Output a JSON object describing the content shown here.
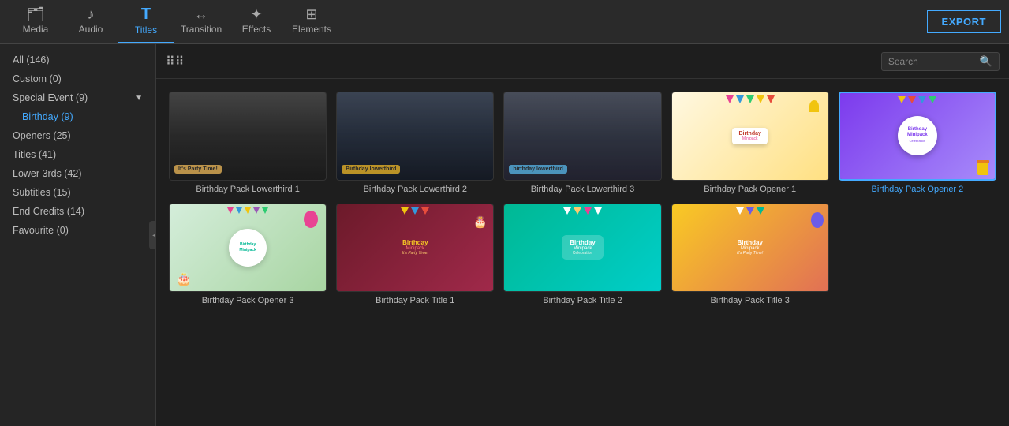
{
  "topNav": {
    "items": [
      {
        "id": "media",
        "label": "Media",
        "icon": "🗂"
      },
      {
        "id": "audio",
        "label": "Audio",
        "icon": "♪"
      },
      {
        "id": "titles",
        "label": "Titles",
        "icon": "T",
        "active": true
      },
      {
        "id": "transition",
        "label": "Transition",
        "icon": "↔"
      },
      {
        "id": "effects",
        "label": "Effects",
        "icon": "✦"
      },
      {
        "id": "elements",
        "label": "Elements",
        "icon": "⊞"
      }
    ],
    "exportLabel": "EXPORT"
  },
  "sidebar": {
    "items": [
      {
        "label": "All (146)",
        "active": false,
        "indent": false
      },
      {
        "label": "Custom (0)",
        "active": false,
        "indent": false
      },
      {
        "label": "Special Event (9)",
        "active": false,
        "indent": false,
        "hasArrow": true
      },
      {
        "label": "Birthday (9)",
        "active": true,
        "indent": true
      },
      {
        "label": "Openers (25)",
        "active": false,
        "indent": false
      },
      {
        "label": "Titles (41)",
        "active": false,
        "indent": false
      },
      {
        "label": "Lower 3rds (42)",
        "active": false,
        "indent": false
      },
      {
        "label": "Subtitles (15)",
        "active": false,
        "indent": false
      },
      {
        "label": "End Credits (14)",
        "active": false,
        "indent": false
      },
      {
        "label": "Favourite (0)",
        "active": false,
        "indent": false
      }
    ]
  },
  "toolbar": {
    "searchPlaceholder": "Search"
  },
  "grid": {
    "items": [
      {
        "id": "lowerthird1",
        "label": "Birthday Pack Lowerthird 1",
        "type": "photo",
        "selected": false
      },
      {
        "id": "lowerthird2",
        "label": "Birthday Pack Lowerthird 2",
        "type": "photo",
        "selected": false
      },
      {
        "id": "lowerthird3",
        "label": "Birthday Pack Lowerthird 3",
        "type": "photo",
        "selected": false
      },
      {
        "id": "opener1",
        "label": "Birthday Pack Opener 1",
        "type": "opener1",
        "selected": false
      },
      {
        "id": "opener2",
        "label": "Birthday Pack Opener 2",
        "type": "opener2",
        "selected": true
      },
      {
        "id": "opener3",
        "label": "Birthday Pack Opener 3",
        "type": "opener3",
        "selected": false
      },
      {
        "id": "title1",
        "label": "Birthday Pack Title 1",
        "type": "title1",
        "selected": false
      },
      {
        "id": "title2",
        "label": "Birthday Pack Title 2",
        "type": "title2",
        "selected": false
      },
      {
        "id": "title3",
        "label": "Birthday Pack Title 3",
        "type": "title3",
        "selected": false
      }
    ]
  }
}
